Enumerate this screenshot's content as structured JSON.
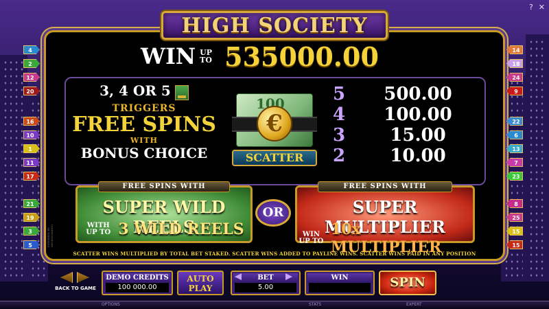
{
  "game": {
    "title": "HIGH SOCIETY",
    "win_prefix": "WIN",
    "win_upto": "UP TO",
    "win_amount": "535000.00"
  },
  "scatter_info": {
    "line1": "3, 4 OR 5",
    "line2": "TRIGGERS",
    "line3": "FREE SPINS",
    "line4": "WITH",
    "line5": "BONUS CHOICE",
    "symbol_label": "SCATTER",
    "bill_text": "100",
    "coin_glyph": "€",
    "payouts": [
      {
        "count": "5",
        "value": "500.00"
      },
      {
        "count": "4",
        "value": "100.00"
      },
      {
        "count": "3",
        "value": "15.00"
      },
      {
        "count": "2",
        "value": "10.00"
      }
    ]
  },
  "features": {
    "left": {
      "header": "FREE SPINS WITH",
      "main": "SUPER WILD REELS",
      "sub_small": "WITH UP TO",
      "sub_big": "3 WILD REELS"
    },
    "or_label": "OR",
    "right": {
      "header": "FREE SPINS WITH",
      "main": "SUPER MULTIPLIER",
      "sub_small": "WIN UP TO",
      "sub_big": "10x MULTIPLIER"
    }
  },
  "disclaimer": "SCATTER WINS MULTIPLIED BY TOTAL BET STAKED. SCATTER WINS ADDED TO PAYLINE WINS. SCATTER WINS PAID IN ANY POSITION",
  "credit_vertical": "POWERED BY MICROGAMING",
  "paylines": {
    "left": [
      {
        "n": "4",
        "color": "#2a8ad0"
      },
      {
        "n": "2",
        "color": "#3aa83a"
      },
      {
        "n": "12",
        "color": "#c83a8a"
      },
      {
        "n": "20",
        "color": "#a01818"
      },
      {
        "n": "16",
        "color": "#c84a18"
      },
      {
        "n": "10",
        "color": "#7a3ac8"
      },
      {
        "n": "1",
        "color": "#d8c018"
      },
      {
        "n": "11",
        "color": "#7a3ac8"
      },
      {
        "n": "17",
        "color": "#c82a18"
      },
      {
        "n": "21",
        "color": "#3aa83a"
      },
      {
        "n": "19",
        "color": "#c8a018"
      },
      {
        "n": "3",
        "color": "#3aa83a"
      },
      {
        "n": "5",
        "color": "#2a5ad0"
      }
    ],
    "right": [
      {
        "n": "14",
        "color": "#e07a3a"
      },
      {
        "n": "18",
        "color": "#c8a0e8"
      },
      {
        "n": "24",
        "color": "#c83a8a"
      },
      {
        "n": "9",
        "color": "#c81818"
      },
      {
        "n": "22",
        "color": "#3a8ad0"
      },
      {
        "n": "6",
        "color": "#2a8ad0"
      },
      {
        "n": "13",
        "color": "#3aa8c8"
      },
      {
        "n": "7",
        "color": "#c83aa8"
      },
      {
        "n": "23",
        "color": "#3ac83a"
      },
      {
        "n": "8",
        "color": "#c82a8a"
      },
      {
        "n": "25",
        "color": "#c83a8a"
      },
      {
        "n": "15",
        "color": "#d8c018"
      },
      {
        "n": "15",
        "color": "#c82a18"
      }
    ]
  },
  "controls": {
    "back_label": "BACK TO GAME",
    "credits_title": "DEMO CREDITS",
    "credits_value": "100 000.00",
    "autoplay_line1": "AUTO",
    "autoplay_line2": "PLAY",
    "bet_title": "BET",
    "bet_value": "5.00",
    "win_title": "WIN",
    "win_value": "",
    "spin_label": "SPIN"
  },
  "bottom_bar": {
    "options": "OPTIONS",
    "stats": "STATS",
    "expert": "EXPERT"
  },
  "top_icons": {
    "help": "?",
    "close": "✕"
  }
}
